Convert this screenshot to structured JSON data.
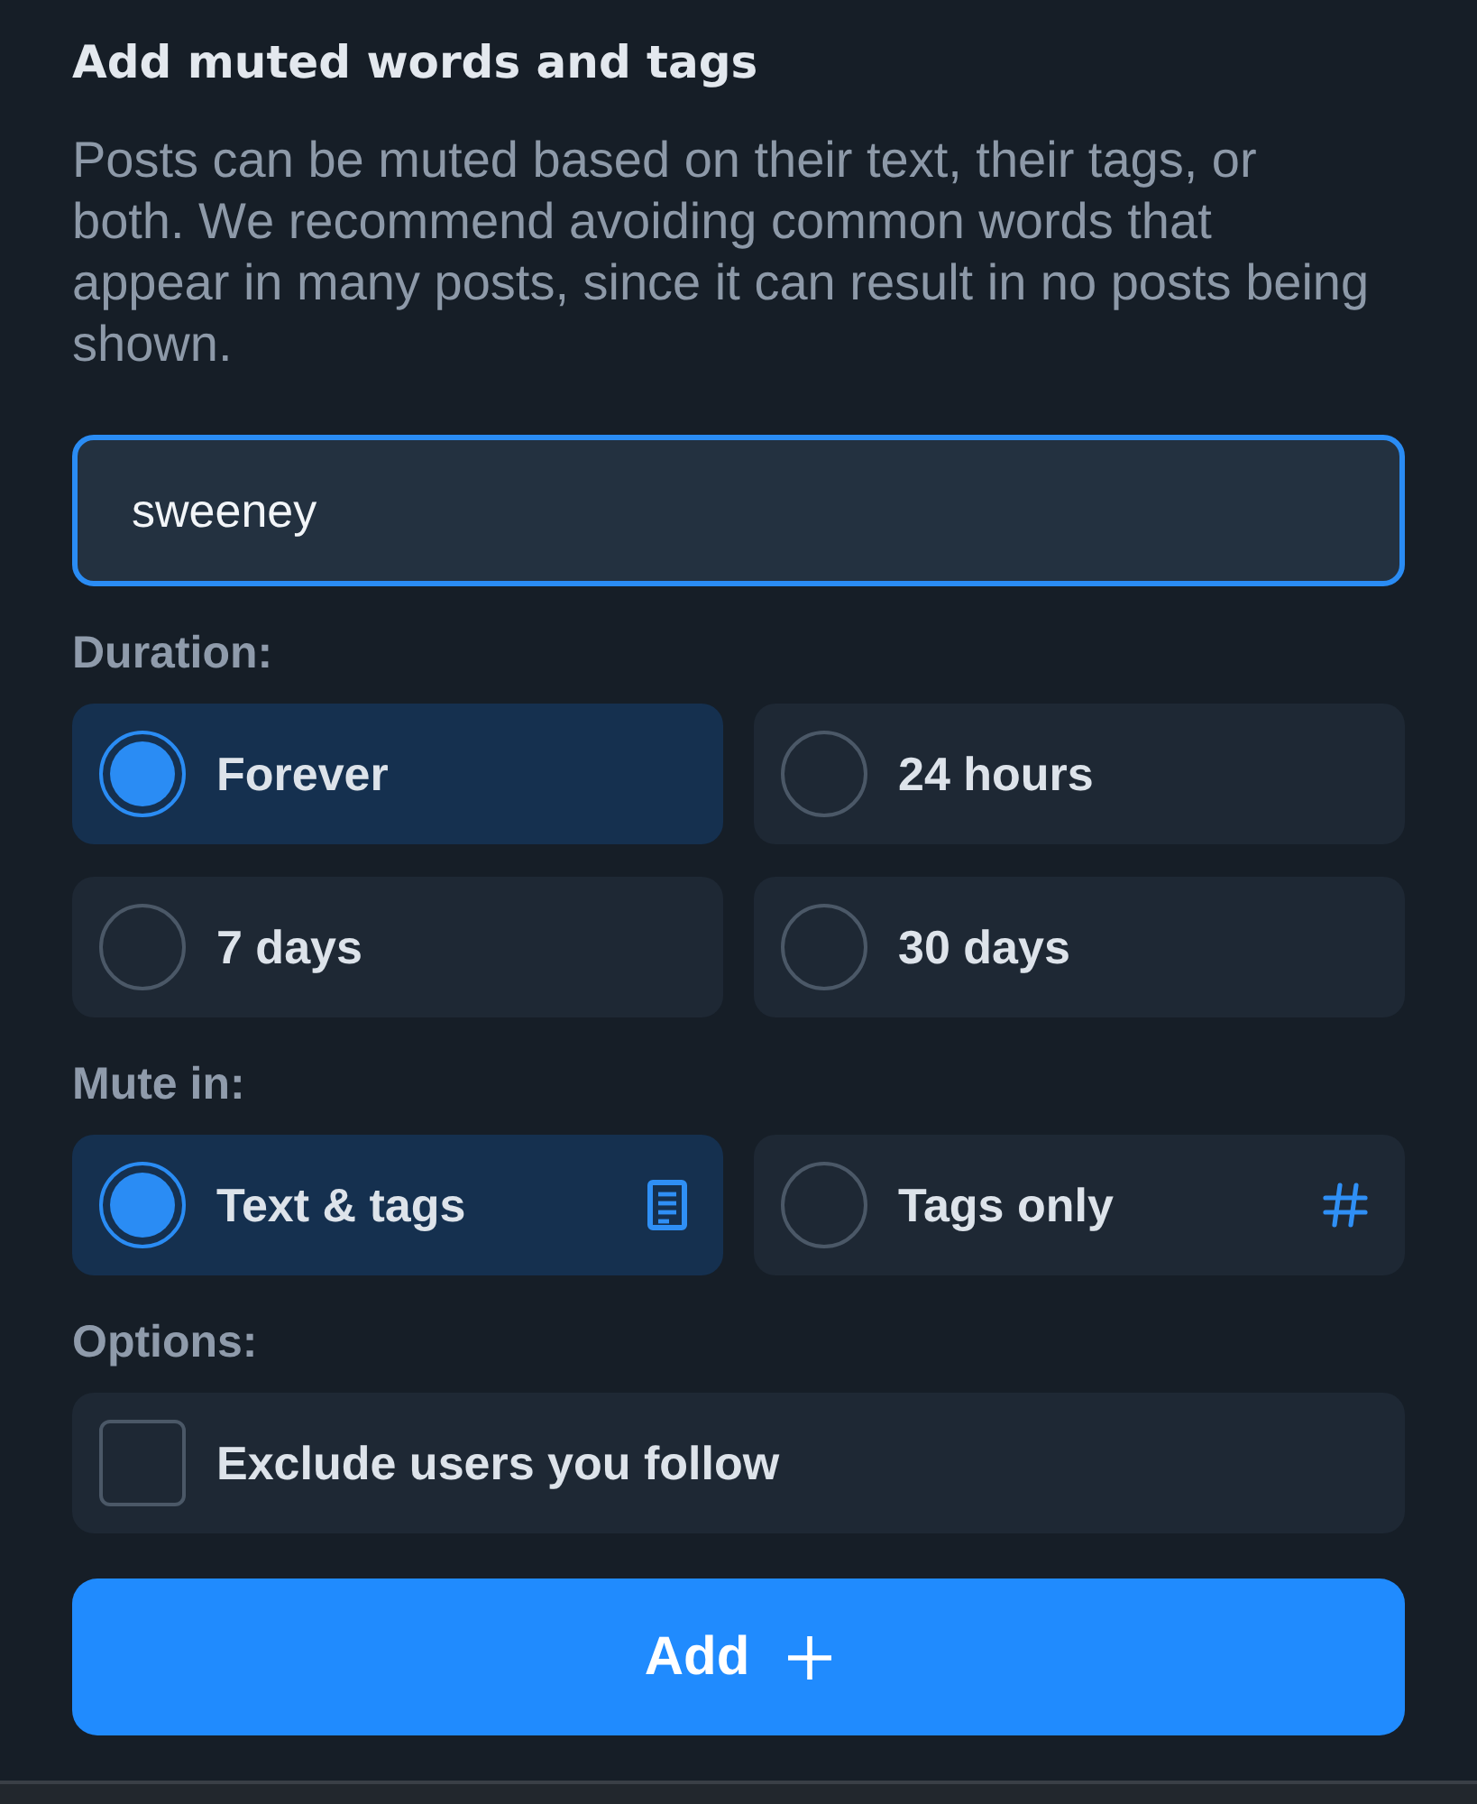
{
  "title": "Add muted words and tags",
  "description": "Posts can be muted based on their text, their tags, or both. We recommend avoiding common words that appear in many posts, since it can result in no posts being shown.",
  "input": {
    "value": "sweeney",
    "focused": true
  },
  "sections": [
    {
      "label": "Duration:",
      "kind": "radio",
      "options": [
        {
          "label": "Forever",
          "selected": true
        },
        {
          "label": "24 hours",
          "selected": false
        },
        {
          "label": "7 days",
          "selected": false
        },
        {
          "label": "30 days",
          "selected": false
        }
      ]
    },
    {
      "label": "Mute in:",
      "kind": "radio",
      "options": [
        {
          "label": "Text & tags",
          "selected": true,
          "kind": "text"
        },
        {
          "label": "Tags only",
          "selected": false,
          "kind": "tags"
        }
      ]
    },
    {
      "label": "Options:",
      "kind": "checkbox",
      "options": [
        {
          "label": "Exclude users you follow",
          "checked": false
        }
      ]
    }
  ],
  "button": {
    "label": "Add"
  }
}
